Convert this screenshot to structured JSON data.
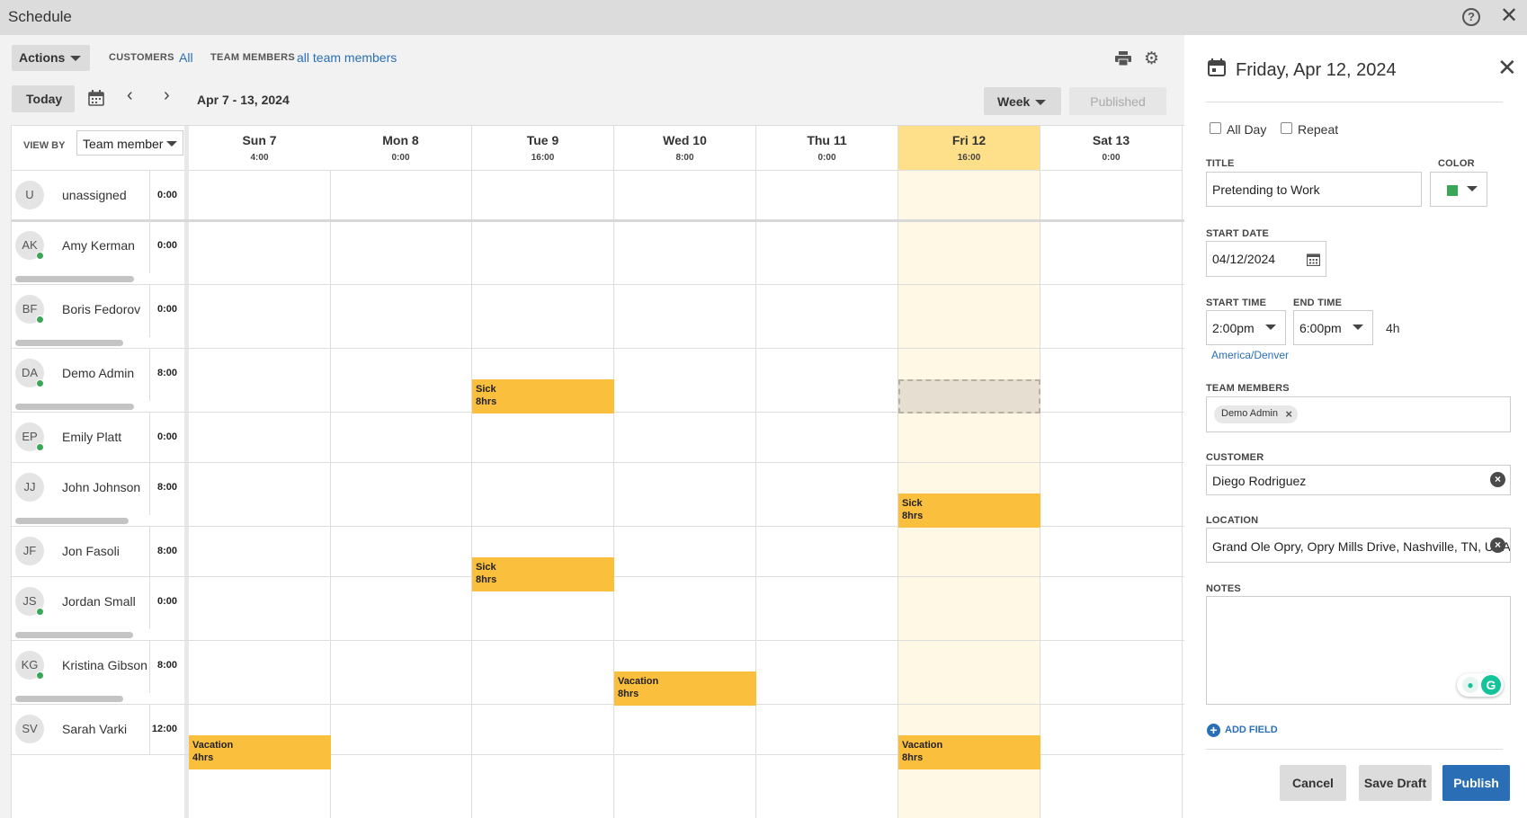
{
  "window": {
    "title": "Schedule"
  },
  "toolbar": {
    "actions_label": "Actions",
    "customers_label": "CUSTOMERS",
    "customers_value": "All",
    "team_label": "TEAM MEMBERS",
    "team_value": "all team members",
    "today_label": "Today",
    "date_range": "Apr 7 - 13, 2024",
    "view_mode": "Week",
    "published_label": "Published"
  },
  "grid": {
    "view_by_label": "VIEW BY",
    "view_by_value": "Team member",
    "days": [
      {
        "name": "Sun 7",
        "hours": "4:00",
        "today": false
      },
      {
        "name": "Mon 8",
        "hours": "0:00",
        "today": false
      },
      {
        "name": "Tue 9",
        "hours": "16:00",
        "today": false
      },
      {
        "name": "Wed 10",
        "hours": "8:00",
        "today": false
      },
      {
        "name": "Thu 11",
        "hours": "0:00",
        "today": false
      },
      {
        "name": "Fri 12",
        "hours": "16:00",
        "today": true
      },
      {
        "name": "Sat 13",
        "hours": "0:00",
        "today": false
      }
    ],
    "members": [
      {
        "initials": "U",
        "name": "unassigned",
        "hours": "0:00",
        "online": false,
        "bar": 0
      },
      {
        "initials": "AK",
        "name": "Amy Kerman",
        "hours": "0:00",
        "online": true,
        "bar": 0.88
      },
      {
        "initials": "BF",
        "name": "Boris Fedorov",
        "hours": "0:00",
        "online": true,
        "bar": 0.8
      },
      {
        "initials": "DA",
        "name": "Demo Admin",
        "hours": "8:00",
        "online": true,
        "bar": 0.88
      },
      {
        "initials": "EP",
        "name": "Emily Platt",
        "hours": "0:00",
        "online": true,
        "bar": 0
      },
      {
        "initials": "JJ",
        "name": "John Johnson",
        "hours": "8:00",
        "online": false,
        "bar": 0.84
      },
      {
        "initials": "JF",
        "name": "Jon Fasoli",
        "hours": "8:00",
        "online": false,
        "bar": 0
      },
      {
        "initials": "JS",
        "name": "Jordan Small",
        "hours": "0:00",
        "online": true,
        "bar": 0.87
      },
      {
        "initials": "KG",
        "name": "Kristina Gibson",
        "hours": "8:00",
        "online": true,
        "bar": 0.8
      },
      {
        "initials": "SV",
        "name": "Sarah Varki",
        "hours": "12:00",
        "online": false,
        "bar": 0
      }
    ],
    "events": [
      {
        "member": 3,
        "day": 2,
        "title": "Sick",
        "duration": "8hrs"
      },
      {
        "member": 5,
        "day": 5,
        "title": "Sick",
        "duration": "8hrs"
      },
      {
        "member": 6,
        "day": 2,
        "title": "Sick",
        "duration": "8hrs"
      },
      {
        "member": 8,
        "day": 3,
        "title": "Vacation",
        "duration": "8hrs"
      },
      {
        "member": 9,
        "day": 0,
        "title": "Vacation",
        "duration": "4hrs"
      },
      {
        "member": 9,
        "day": 5,
        "title": "Vacation",
        "duration": "8hrs"
      }
    ],
    "draft_slot": {
      "member": 3,
      "day": 5
    }
  },
  "panel": {
    "date": "Friday, Apr 12, 2024",
    "all_day_label": "All Day",
    "repeat_label": "Repeat",
    "title_label": "TITLE",
    "title_value": "Pretending to Work",
    "color_label": "COLOR",
    "color_value": "#3aa757",
    "start_date_label": "START DATE",
    "start_date_value": "04/12/2024",
    "start_time_label": "START TIME",
    "start_time_value": "2:00pm",
    "end_time_label": "END TIME",
    "end_time_value": "6:00pm",
    "duration": "4h",
    "timezone": "America/Denver",
    "team_members_label": "TEAM MEMBERS",
    "team_members": [
      "Demo Admin"
    ],
    "customer_label": "CUSTOMER",
    "customer_value": "Diego Rodriguez",
    "location_label": "LOCATION",
    "location_value": "Grand Ole Opry, Opry Mills Drive, Nashville, TN, USA",
    "notes_label": "NOTES",
    "notes_value": "",
    "add_field_label": "ADD FIELD",
    "cancel_label": "Cancel",
    "save_draft_label": "Save Draft",
    "publish_label": "Publish"
  },
  "icons": {
    "calendar": "calendar-icon",
    "print": "print-icon",
    "settings": "gear-icon",
    "help": "help-icon",
    "close": "close-icon"
  },
  "colors": {
    "event": "#fbbf3e",
    "today_header": "#ffe08a",
    "today_column": "#fff8e4",
    "accent": "#2a6fb6",
    "online": "#3aa757"
  }
}
